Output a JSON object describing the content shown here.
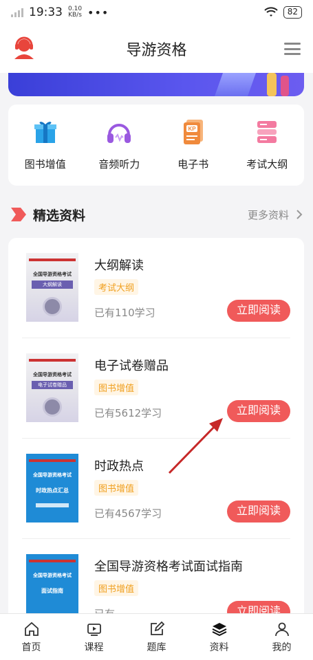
{
  "status_bar": {
    "time": "19:33",
    "speed_value": "0.10",
    "speed_unit": "KB/s",
    "dots": "•••",
    "battery": "82"
  },
  "header": {
    "title": "导游资格"
  },
  "categories": [
    {
      "label": "图书增值",
      "icon": "gift-box-icon"
    },
    {
      "label": "音频听力",
      "icon": "headphones-icon"
    },
    {
      "label": "电子书",
      "icon": "ebook-icon"
    },
    {
      "label": "考试大纲",
      "icon": "outline-icon"
    }
  ],
  "section": {
    "title": "精选资料",
    "more": "更多资料"
  },
  "items": [
    {
      "title": "大纲解读",
      "tag": "考试大纲",
      "count": "已有110学习",
      "button": "立即阅读",
      "cover_title": "全国导游资格考试",
      "cover_sub": "大纲解读"
    },
    {
      "title": "电子试卷赠品",
      "tag": "图书增值",
      "count": "已有5612学习",
      "button": "立即阅读",
      "cover_title": "全国导游资格考试",
      "cover_sub": "电子试卷赠品"
    },
    {
      "title": "时政热点",
      "tag": "图书增值",
      "count": "已有4567学习",
      "button": "立即阅读",
      "cover_title": "全国导游资格考试",
      "cover_sub": "时政热点汇总"
    },
    {
      "title": "全国导游资格考试面试指南",
      "tag": "图书增值",
      "count": "已有",
      "button": "立即阅读",
      "cover_title": "全国导游资格考试",
      "cover_sub": "面试指南"
    }
  ],
  "tabs": [
    {
      "label": "首页",
      "icon": "home-icon"
    },
    {
      "label": "课程",
      "icon": "play-icon"
    },
    {
      "label": "题库",
      "icon": "edit-icon"
    },
    {
      "label": "资料",
      "icon": "layers-icon"
    },
    {
      "label": "我的",
      "icon": "user-icon"
    }
  ],
  "colors": {
    "accent": "#f05a5a",
    "tag_text": "#f0a020",
    "tag_bg": "#fff5e5"
  }
}
